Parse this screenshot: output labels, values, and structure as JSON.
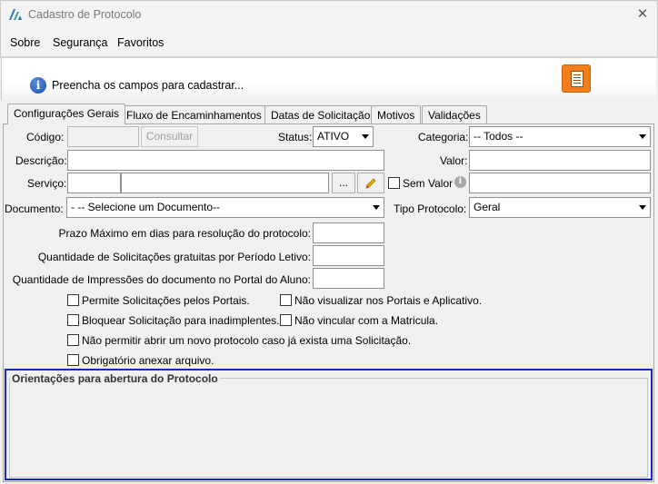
{
  "window": {
    "title": "Cadastro de Protocolo",
    "close_glyph": "✕"
  },
  "menu": {
    "items": [
      {
        "label": "Sobre"
      },
      {
        "label": "Segurança"
      },
      {
        "label": "Favoritos"
      }
    ]
  },
  "header": {
    "message": "Preencha os campos para cadastrar..."
  },
  "tabs": [
    {
      "label": "Configurações Gerais"
    },
    {
      "label": "Fluxo de Encaminhamentos"
    },
    {
      "label": "Datas de Solicitação"
    },
    {
      "label": "Motivos"
    },
    {
      "label": "Validações"
    }
  ],
  "form": {
    "codigo_label": "Código:",
    "codigo_value": "",
    "consultar_label": "Consultar",
    "status_label": "Status:",
    "status_value": "ATIVO",
    "categoria_label": "Categoria:",
    "categoria_value": "-- Todos --",
    "descricao_label": "Descrição:",
    "descricao_value": "",
    "valor_label": "Valor:",
    "valor_value": "",
    "servico_label": "Serviço:",
    "servico_code": "",
    "servico_name": "",
    "ellipsis_label": "...",
    "sem_valor_label": "Sem Valor",
    "sem_valor_field": "",
    "documento_label": "Documento:",
    "documento_value": "- -- Selecione um Documento--",
    "tipo_protocolo_label": "Tipo Protocolo:",
    "tipo_protocolo_value": "Geral",
    "prazo_label": "Prazo Máximo em dias para resolução do protocolo:",
    "prazo_value": "",
    "qtd_solic_label": "Quantidade de Solicitações gratuitas por Período Letivo:",
    "qtd_solic_value": "",
    "qtd_impr_label": "Quantidade de Impressões do documento no Portal do Aluno:",
    "qtd_impr_value": "",
    "checkboxes": [
      {
        "label": "Permite Solicitações pelos Portais.",
        "checked": false
      },
      {
        "label": "Não visualizar nos Portais e Aplicativo.",
        "checked": false
      },
      {
        "label": "Bloquear Solicitação para inadimplentes.",
        "checked": false
      },
      {
        "label": "Não vincular com a Matricula.",
        "checked": false
      },
      {
        "label": "Não permitir abrir um novo protocolo caso já exista uma Solicitação.",
        "checked": false
      },
      {
        "label": "Obrigatório anexar arquivo.",
        "checked": false
      }
    ],
    "orientacoes_label": "Orientações para abertura do Protocolo",
    "orientacoes_value": ""
  },
  "colors": {
    "accent_orange": "#f07e1a",
    "group_border": "#1428c8",
    "info_blue": "#1c4fb0"
  }
}
